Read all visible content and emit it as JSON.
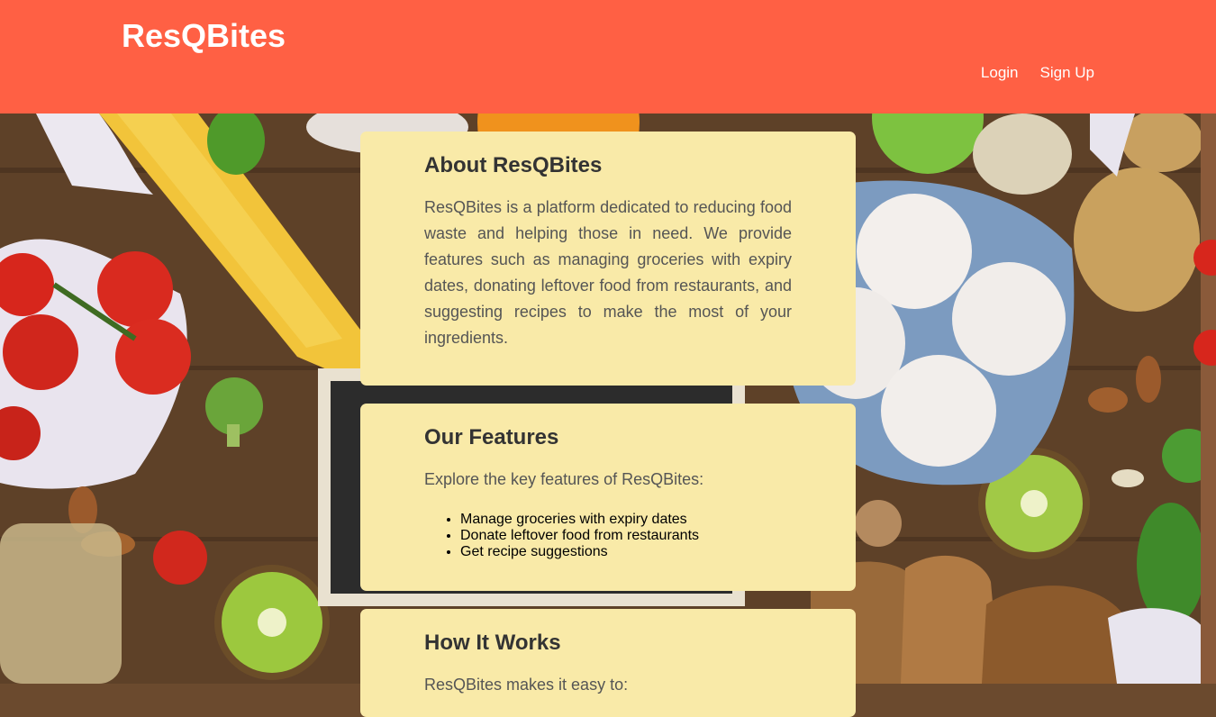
{
  "header": {
    "brand": "ResQBites",
    "nav": {
      "login": "Login",
      "signup": "Sign Up"
    }
  },
  "colors": {
    "header_bg": "#ff6044",
    "card_bg": "#f9eaa8"
  },
  "about": {
    "title": "About ResQBites",
    "text": "ResQBites is a platform dedicated to reducing food waste and helping those in need. We provide features such as managing groceries with expiry dates, donating leftover food from restaurants, and suggesting recipes to make the most of your ingredients."
  },
  "features": {
    "title": "Our Features",
    "intro": "Explore the key features of ResQBites:",
    "items": [
      "Manage groceries with expiry dates",
      "Donate leftover food from restaurants",
      "Get recipe suggestions"
    ]
  },
  "how": {
    "title": "How It Works",
    "intro": "ResQBites makes it easy to:"
  }
}
